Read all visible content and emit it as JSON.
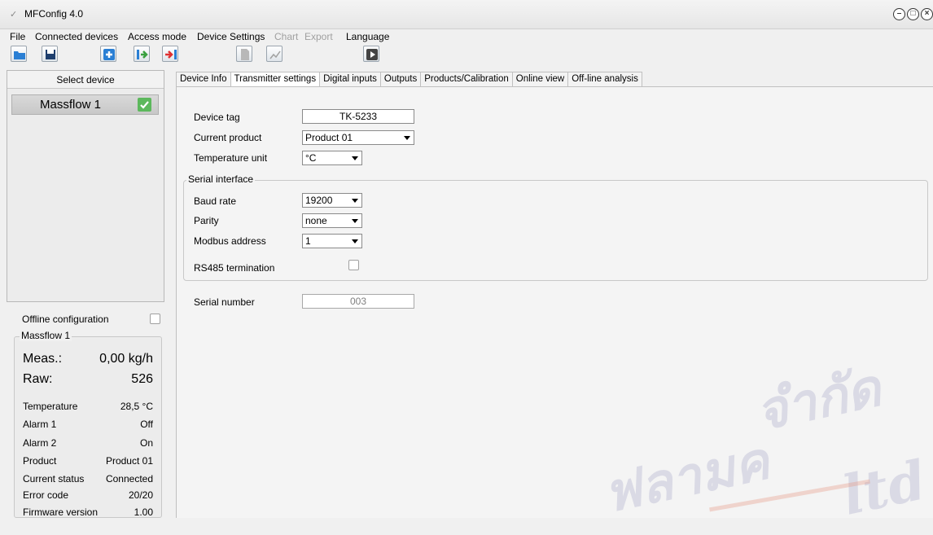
{
  "window": {
    "title": "MFConfig 4.0"
  },
  "menu": {
    "file": "File",
    "connected": "Connected devices",
    "access": "Access mode",
    "device_settings": "Device Settings",
    "chart": "Chart",
    "export": "Export",
    "language": "Language"
  },
  "toolbar": {
    "icons": [
      "open-folder-icon",
      "save-icon",
      "add-device-icon",
      "connect-icon",
      "disconnect-icon",
      "document-icon",
      "chart-icon",
      "play-icon"
    ]
  },
  "sidebar": {
    "header": "Select device",
    "devices": [
      {
        "name": "Massflow 1",
        "checked": true
      }
    ],
    "offline_label": "Offline configuration",
    "group_title": "Massflow 1",
    "meas_label": "Meas.:",
    "meas_value": "0,00 kg/h",
    "raw_label": "Raw:",
    "raw_value": "526",
    "rows": [
      {
        "label": "Temperature",
        "value": "28,5 °C"
      },
      {
        "label": "Alarm 1",
        "value": "Off"
      },
      {
        "label": "Alarm 2",
        "value": "On"
      },
      {
        "label": "Product",
        "value": "Product 01"
      },
      {
        "label": "Current status",
        "value": "Connected"
      },
      {
        "label": "Error code",
        "value": "20/20"
      },
      {
        "label": "Firmware version",
        "value": "1.00"
      }
    ]
  },
  "tabs": [
    "Device Info",
    "Transmitter settings",
    "Digital inputs",
    "Outputs",
    "Products/Calibration",
    "Online view",
    "Off-line analysis"
  ],
  "active_tab": "Transmitter settings",
  "form": {
    "device_tag_label": "Device tag",
    "device_tag": "TK-5233",
    "current_product_label": "Current product",
    "current_product": "Product 01",
    "temp_unit_label": "Temperature unit",
    "temp_unit": "°C",
    "serial_interface_label": "Serial interface",
    "baud_label": "Baud rate",
    "baud": "19200",
    "parity_label": "Parity",
    "parity": "none",
    "modbus_label": "Modbus address",
    "modbus": "1",
    "rs485_label": "RS485 termination",
    "serial_number_label": "Serial number",
    "serial_number": "003"
  },
  "watermark": {
    "line1": "จำกัด",
    "line2": "ฟลามค",
    "line3": "ltd"
  },
  "colors": {
    "check_green": "#5cb85c",
    "disconnect_red": "#e03030",
    "add_blue": "#2a7fd4",
    "watermark": "#c8c8d8"
  }
}
